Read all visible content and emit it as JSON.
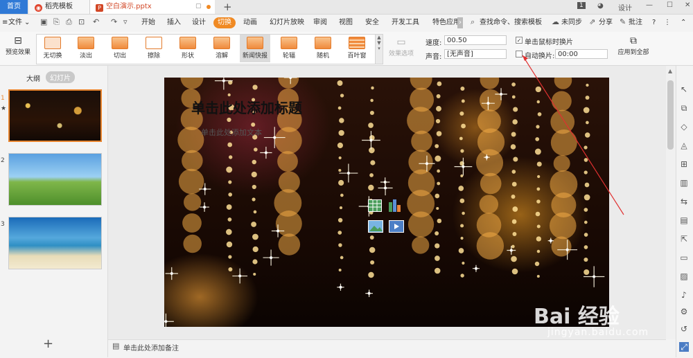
{
  "titlebar": {
    "tab_home": "首页",
    "tab_daoke": "稻壳模板",
    "tab_doc": "空白演示.pptx",
    "tab_doc_close": "▢",
    "new_tab": "+",
    "page_badge": "1",
    "design_label": "设计",
    "win_min": "—",
    "win_max": "☐",
    "win_close": "✕"
  },
  "menubar": {
    "file_label": "文件",
    "items": [
      "开始",
      "插入",
      "设计",
      "切换",
      "动画",
      "幻灯片放映",
      "审阅",
      "视图",
      "安全",
      "开发工具",
      "特色应用"
    ],
    "active": "切换",
    "search_label": "查找命令、搜索模板",
    "sync_label": "未同步",
    "share_label": "分享",
    "annotate_label": "批注",
    "help": "?"
  },
  "ribbon": {
    "preview_label": "预览效果",
    "effects": [
      "无切换",
      "淡出",
      "切出",
      "擦除",
      "形状",
      "溶解",
      "新闻快报",
      "轮辐",
      "随机",
      "百叶窗"
    ],
    "selected_effect": "新闻快报",
    "effect_options_label": "效果选项",
    "speed_label": "速度:",
    "speed_value": "00.50",
    "sound_label": "声音:",
    "sound_value": "[无声音]",
    "on_click_label": "单击鼠标时换片",
    "on_click_checked": true,
    "auto_label": "自动换片:",
    "auto_checked": false,
    "auto_value": "00:00",
    "apply_all_label": "应用到全部"
  },
  "left_pane": {
    "outline_label": "大纲",
    "slides_label": "幻灯片",
    "slides": [
      {
        "num": "1",
        "theme": "sparkle"
      },
      {
        "num": "2",
        "theme": "meadow"
      },
      {
        "num": "3",
        "theme": "beach"
      }
    ],
    "add_label": "+"
  },
  "slide": {
    "title_placeholder": "单击此处添加标题",
    "subtitle_placeholder": "单击此处添加文本"
  },
  "notes": {
    "placeholder": "单击此处添加备注"
  },
  "watermark": {
    "brand": "Bai 经验",
    "url": "jingyan.baidu.com"
  },
  "colors": {
    "accent": "#f08a24",
    "home_tab": "#2f79d6",
    "annotation_arrow": "#e03030"
  }
}
